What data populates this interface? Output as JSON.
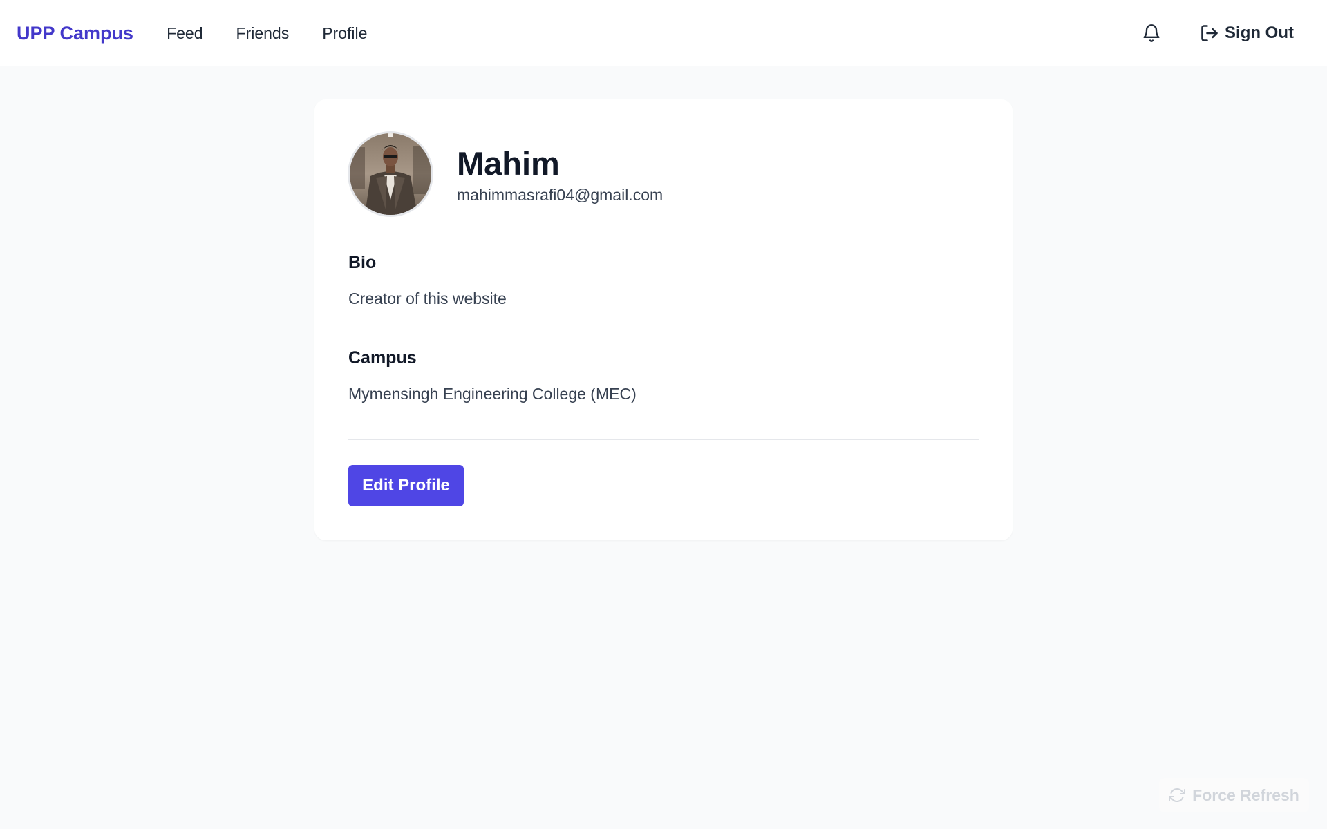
{
  "navbar": {
    "brand": "UPP Campus",
    "links": [
      "Feed",
      "Friends",
      "Profile"
    ],
    "signout_label": "Sign Out",
    "icons": {
      "notifications": "bell-icon",
      "signout": "sign-out-icon"
    }
  },
  "profile": {
    "name": "Mahim",
    "email": "mahimmasrafi04@gmail.com",
    "bio_label": "Bio",
    "bio": "Creator of this website",
    "campus_label": "Campus",
    "campus": "Mymensingh Engineering College (MEC)",
    "edit_button": "Edit Profile"
  },
  "footer": {
    "force_refresh_label": "Force Refresh",
    "force_refresh_icon": "refresh-icon"
  },
  "colors": {
    "accent": "#4f46e5",
    "brand": "#4338ca",
    "page_bg": "#f9fafb",
    "card_bg": "#ffffff"
  }
}
